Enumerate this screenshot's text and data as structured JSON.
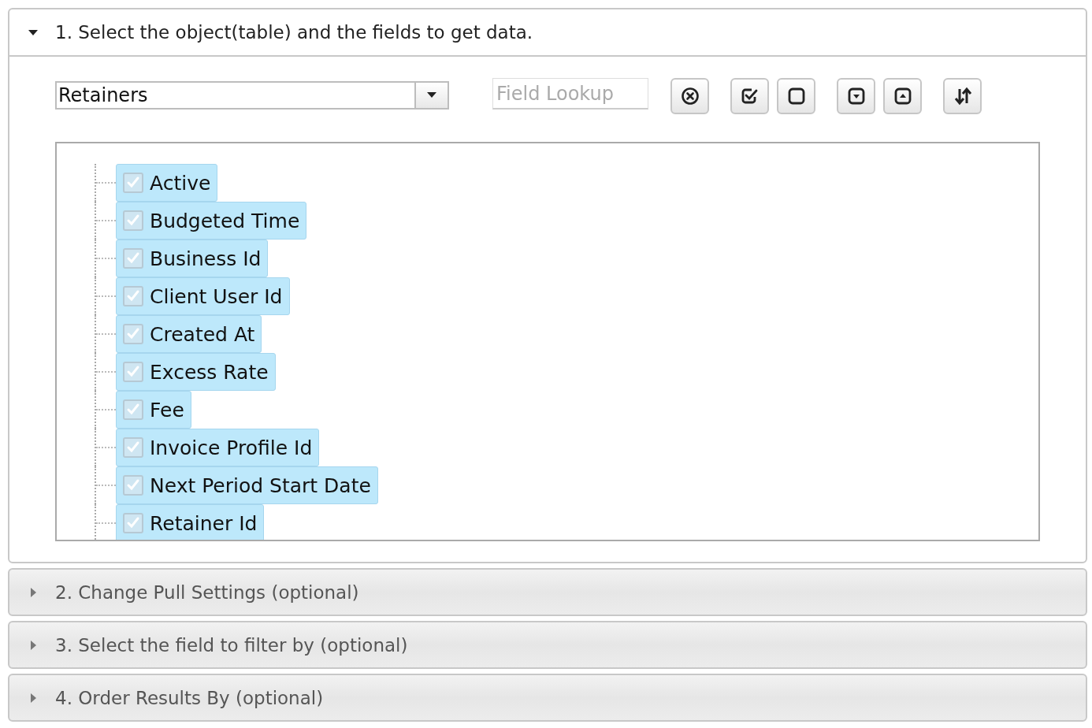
{
  "sections": [
    {
      "title": "1. Select the object(table) and the fields to get data.",
      "expanded": true
    },
    {
      "title": "2. Change Pull Settings (optional)",
      "expanded": false
    },
    {
      "title": "3. Select the field to filter by (optional)",
      "expanded": false
    },
    {
      "title": "4. Order Results By (optional)",
      "expanded": false
    }
  ],
  "object_select": {
    "value": "Retainers"
  },
  "field_lookup": {
    "placeholder": "Field Lookup"
  },
  "tool_groups": [
    [
      {
        "kind": "clear"
      }
    ],
    [
      {
        "kind": "check-all"
      },
      {
        "kind": "uncheck-all"
      }
    ],
    [
      {
        "kind": "collapse"
      },
      {
        "kind": "expand"
      }
    ],
    [
      {
        "kind": "sort"
      }
    ]
  ],
  "fields": [
    {
      "label": "Active",
      "checked": true,
      "selected": true
    },
    {
      "label": "Budgeted Time",
      "checked": true,
      "selected": true
    },
    {
      "label": "Business Id",
      "checked": true,
      "selected": true
    },
    {
      "label": "Client User Id",
      "checked": true,
      "selected": true
    },
    {
      "label": "Created At",
      "checked": true,
      "selected": true
    },
    {
      "label": "Excess Rate",
      "checked": true,
      "selected": true
    },
    {
      "label": "Fee",
      "checked": true,
      "selected": true
    },
    {
      "label": "Invoice Profile Id",
      "checked": true,
      "selected": true
    },
    {
      "label": "Next Period Start Date",
      "checked": true,
      "selected": true
    },
    {
      "label": "Retainer Id",
      "checked": true,
      "selected": true
    }
  ]
}
